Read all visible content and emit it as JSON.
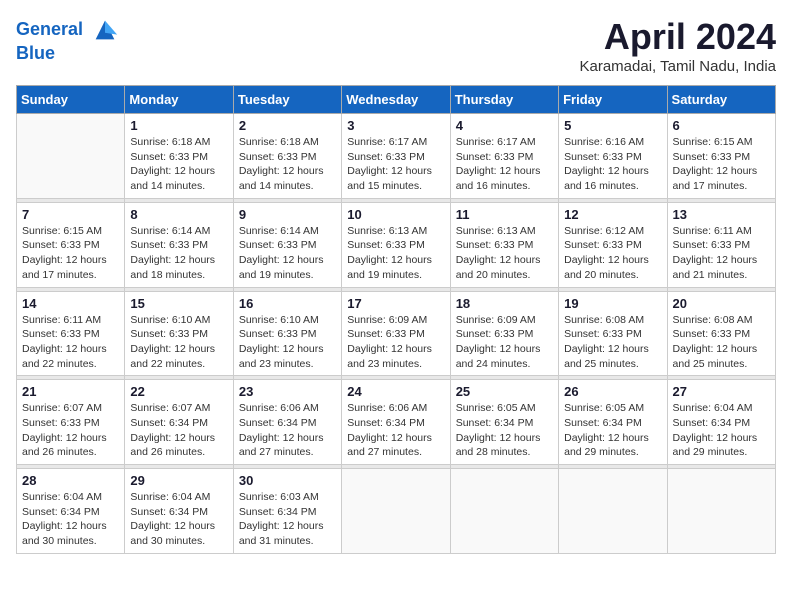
{
  "header": {
    "logo_line1": "General",
    "logo_line2": "Blue",
    "month_year": "April 2024",
    "location": "Karamadai, Tamil Nadu, India"
  },
  "weekdays": [
    "Sunday",
    "Monday",
    "Tuesday",
    "Wednesday",
    "Thursday",
    "Friday",
    "Saturday"
  ],
  "weeks": [
    [
      {
        "day": "",
        "sunrise": "",
        "sunset": "",
        "daylight": ""
      },
      {
        "day": "1",
        "sunrise": "Sunrise: 6:18 AM",
        "sunset": "Sunset: 6:33 PM",
        "daylight": "Daylight: 12 hours and 14 minutes."
      },
      {
        "day": "2",
        "sunrise": "Sunrise: 6:18 AM",
        "sunset": "Sunset: 6:33 PM",
        "daylight": "Daylight: 12 hours and 14 minutes."
      },
      {
        "day": "3",
        "sunrise": "Sunrise: 6:17 AM",
        "sunset": "Sunset: 6:33 PM",
        "daylight": "Daylight: 12 hours and 15 minutes."
      },
      {
        "day": "4",
        "sunrise": "Sunrise: 6:17 AM",
        "sunset": "Sunset: 6:33 PM",
        "daylight": "Daylight: 12 hours and 16 minutes."
      },
      {
        "day": "5",
        "sunrise": "Sunrise: 6:16 AM",
        "sunset": "Sunset: 6:33 PM",
        "daylight": "Daylight: 12 hours and 16 minutes."
      },
      {
        "day": "6",
        "sunrise": "Sunrise: 6:15 AM",
        "sunset": "Sunset: 6:33 PM",
        "daylight": "Daylight: 12 hours and 17 minutes."
      }
    ],
    [
      {
        "day": "7",
        "sunrise": "Sunrise: 6:15 AM",
        "sunset": "Sunset: 6:33 PM",
        "daylight": "Daylight: 12 hours and 17 minutes."
      },
      {
        "day": "8",
        "sunrise": "Sunrise: 6:14 AM",
        "sunset": "Sunset: 6:33 PM",
        "daylight": "Daylight: 12 hours and 18 minutes."
      },
      {
        "day": "9",
        "sunrise": "Sunrise: 6:14 AM",
        "sunset": "Sunset: 6:33 PM",
        "daylight": "Daylight: 12 hours and 19 minutes."
      },
      {
        "day": "10",
        "sunrise": "Sunrise: 6:13 AM",
        "sunset": "Sunset: 6:33 PM",
        "daylight": "Daylight: 12 hours and 19 minutes."
      },
      {
        "day": "11",
        "sunrise": "Sunrise: 6:13 AM",
        "sunset": "Sunset: 6:33 PM",
        "daylight": "Daylight: 12 hours and 20 minutes."
      },
      {
        "day": "12",
        "sunrise": "Sunrise: 6:12 AM",
        "sunset": "Sunset: 6:33 PM",
        "daylight": "Daylight: 12 hours and 20 minutes."
      },
      {
        "day": "13",
        "sunrise": "Sunrise: 6:11 AM",
        "sunset": "Sunset: 6:33 PM",
        "daylight": "Daylight: 12 hours and 21 minutes."
      }
    ],
    [
      {
        "day": "14",
        "sunrise": "Sunrise: 6:11 AM",
        "sunset": "Sunset: 6:33 PM",
        "daylight": "Daylight: 12 hours and 22 minutes."
      },
      {
        "day": "15",
        "sunrise": "Sunrise: 6:10 AM",
        "sunset": "Sunset: 6:33 PM",
        "daylight": "Daylight: 12 hours and 22 minutes."
      },
      {
        "day": "16",
        "sunrise": "Sunrise: 6:10 AM",
        "sunset": "Sunset: 6:33 PM",
        "daylight": "Daylight: 12 hours and 23 minutes."
      },
      {
        "day": "17",
        "sunrise": "Sunrise: 6:09 AM",
        "sunset": "Sunset: 6:33 PM",
        "daylight": "Daylight: 12 hours and 23 minutes."
      },
      {
        "day": "18",
        "sunrise": "Sunrise: 6:09 AM",
        "sunset": "Sunset: 6:33 PM",
        "daylight": "Daylight: 12 hours and 24 minutes."
      },
      {
        "day": "19",
        "sunrise": "Sunrise: 6:08 AM",
        "sunset": "Sunset: 6:33 PM",
        "daylight": "Daylight: 12 hours and 25 minutes."
      },
      {
        "day": "20",
        "sunrise": "Sunrise: 6:08 AM",
        "sunset": "Sunset: 6:33 PM",
        "daylight": "Daylight: 12 hours and 25 minutes."
      }
    ],
    [
      {
        "day": "21",
        "sunrise": "Sunrise: 6:07 AM",
        "sunset": "Sunset: 6:33 PM",
        "daylight": "Daylight: 12 hours and 26 minutes."
      },
      {
        "day": "22",
        "sunrise": "Sunrise: 6:07 AM",
        "sunset": "Sunset: 6:34 PM",
        "daylight": "Daylight: 12 hours and 26 minutes."
      },
      {
        "day": "23",
        "sunrise": "Sunrise: 6:06 AM",
        "sunset": "Sunset: 6:34 PM",
        "daylight": "Daylight: 12 hours and 27 minutes."
      },
      {
        "day": "24",
        "sunrise": "Sunrise: 6:06 AM",
        "sunset": "Sunset: 6:34 PM",
        "daylight": "Daylight: 12 hours and 27 minutes."
      },
      {
        "day": "25",
        "sunrise": "Sunrise: 6:05 AM",
        "sunset": "Sunset: 6:34 PM",
        "daylight": "Daylight: 12 hours and 28 minutes."
      },
      {
        "day": "26",
        "sunrise": "Sunrise: 6:05 AM",
        "sunset": "Sunset: 6:34 PM",
        "daylight": "Daylight: 12 hours and 29 minutes."
      },
      {
        "day": "27",
        "sunrise": "Sunrise: 6:04 AM",
        "sunset": "Sunset: 6:34 PM",
        "daylight": "Daylight: 12 hours and 29 minutes."
      }
    ],
    [
      {
        "day": "28",
        "sunrise": "Sunrise: 6:04 AM",
        "sunset": "Sunset: 6:34 PM",
        "daylight": "Daylight: 12 hours and 30 minutes."
      },
      {
        "day": "29",
        "sunrise": "Sunrise: 6:04 AM",
        "sunset": "Sunset: 6:34 PM",
        "daylight": "Daylight: 12 hours and 30 minutes."
      },
      {
        "day": "30",
        "sunrise": "Sunrise: 6:03 AM",
        "sunset": "Sunset: 6:34 PM",
        "daylight": "Daylight: 12 hours and 31 minutes."
      },
      {
        "day": "",
        "sunrise": "",
        "sunset": "",
        "daylight": ""
      },
      {
        "day": "",
        "sunrise": "",
        "sunset": "",
        "daylight": ""
      },
      {
        "day": "",
        "sunrise": "",
        "sunset": "",
        "daylight": ""
      },
      {
        "day": "",
        "sunrise": "",
        "sunset": "",
        "daylight": ""
      }
    ]
  ]
}
